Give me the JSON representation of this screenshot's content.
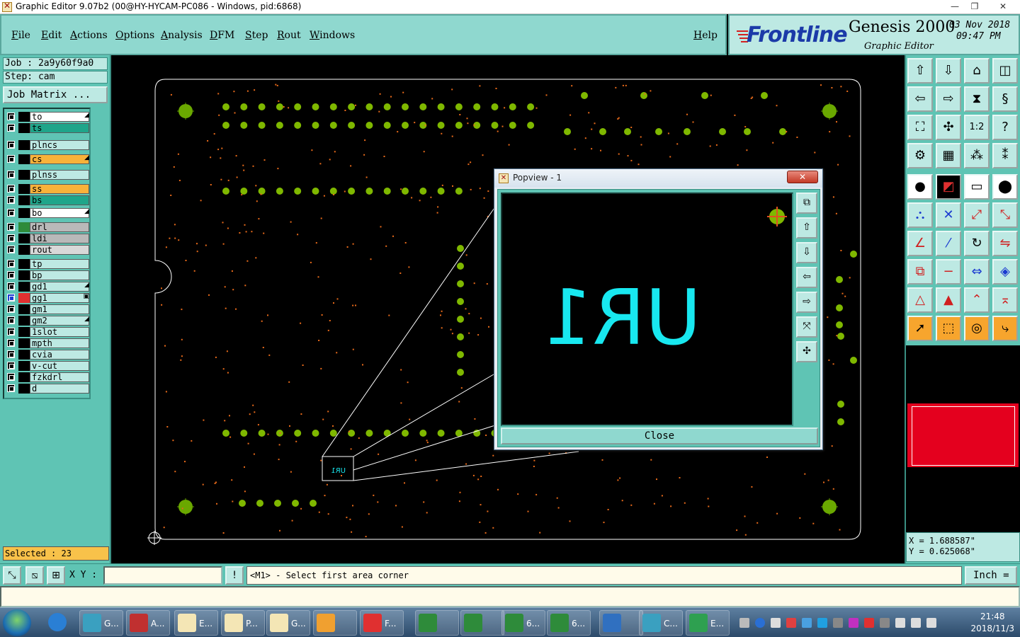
{
  "window": {
    "title": "Graphic Editor 9.07b2 (00@HY-HYCAM-PC086 - Windows, pid:6868)",
    "minimize": "—",
    "restore": "❐",
    "close": "✕"
  },
  "menu": {
    "items": [
      "File",
      "Edit",
      "Actions",
      "Options",
      "Analysis",
      "DFM",
      "Step",
      "Rout",
      "Windows"
    ],
    "help": "Help"
  },
  "brand": {
    "logo": "Frontline",
    "product": "Genesis 2000",
    "subtitle": "Graphic Editor",
    "date": "03 Nov 2018",
    "time": "09:47 PM"
  },
  "job": {
    "job_label": "Job : 2a9y60f9a0",
    "step_label": "Step: cam",
    "matrix_button": "Job Matrix ..."
  },
  "layers": [
    {
      "name": "to",
      "color": "#ffffff",
      "mark": "◢"
    },
    {
      "name": "ts",
      "color": "#1fa58a",
      "mark": ""
    },
    {
      "name": "plncs",
      "color": "#bde9e3",
      "mark": ""
    },
    {
      "name": "cs",
      "color": "#f8b23a",
      "mark": "◢"
    },
    {
      "name": "plnss",
      "color": "#bde9e3",
      "mark": ""
    },
    {
      "name": "ss",
      "color": "#f8b23a",
      "mark": ""
    },
    {
      "name": "bs",
      "color": "#1fa58a",
      "mark": ""
    },
    {
      "name": "bo",
      "color": "#ffffff",
      "mark": "◢"
    },
    {
      "name": "drl",
      "color": "#b9b9b9",
      "mark": ""
    },
    {
      "name": "ldi",
      "color": "#b9b9b9",
      "mark": ""
    },
    {
      "name": "rout",
      "color": "#d8d8d8",
      "mark": ""
    },
    {
      "name": "tp",
      "color": "#bde9e3",
      "mark": ""
    },
    {
      "name": "bp",
      "color": "#bde9e3",
      "mark": ""
    },
    {
      "name": "gd1",
      "color": "#bde9e3",
      "mark": "◢"
    },
    {
      "name": "gg1",
      "color": "#bde9e3",
      "mark": "▣"
    },
    {
      "name": "gm1",
      "color": "#bde9e3",
      "mark": ""
    },
    {
      "name": "gm2",
      "color": "#bde9e3",
      "mark": "◢"
    },
    {
      "name": "1slot",
      "color": "#bde9e3",
      "mark": ""
    },
    {
      "name": "mpth",
      "color": "#bde9e3",
      "mark": ""
    },
    {
      "name": "cvia",
      "color": "#bde9e3",
      "mark": ""
    },
    {
      "name": "v-cut",
      "color": "#bde9e3",
      "mark": ""
    },
    {
      "name": "fzkdrl",
      "color": "#bde9e3",
      "mark": ""
    },
    {
      "name": "d",
      "color": "#bde9e3",
      "mark": ""
    }
  ],
  "selected": "Selected : 23",
  "popview": {
    "title": "Popview - 1",
    "close_x": "✕",
    "label": "UR1",
    "close_button": "Close"
  },
  "coords": {
    "x": "X = 1.688587\"",
    "y": "Y = 0.625068\""
  },
  "bottom": {
    "xy_label": "X Y :",
    "xy_value": "",
    "warn": "!",
    "message": "<M1> - Select first area corner",
    "units": "Inch ="
  },
  "taskbar": {
    "items": [
      {
        "label": "G...",
        "color": "#3aa0c0"
      },
      {
        "label": "A...",
        "color": "#c03030"
      },
      {
        "label": "E...",
        "color": "#f4e6b5"
      },
      {
        "label": "P...",
        "color": "#f4e6b5"
      },
      {
        "label": "G...",
        "color": "#f4e6b5"
      },
      {
        "label": "",
        "color": "#f0a030"
      },
      {
        "label": "F...",
        "color": "#e03030"
      },
      {
        "label": "",
        "color": "#2e8b3a"
      },
      {
        "label": "",
        "color": "#2e8b3a"
      },
      {
        "label": "6...",
        "color": "#2e8b3a"
      },
      {
        "label": "6...",
        "color": "#2e8b3a"
      },
      {
        "label": "",
        "color": "#3070c0"
      },
      {
        "label": "C...",
        "color": "#3aa0c0"
      },
      {
        "label": "E...",
        "color": "#2ea050"
      }
    ],
    "time": "21:48",
    "date": "2018/11/3"
  }
}
